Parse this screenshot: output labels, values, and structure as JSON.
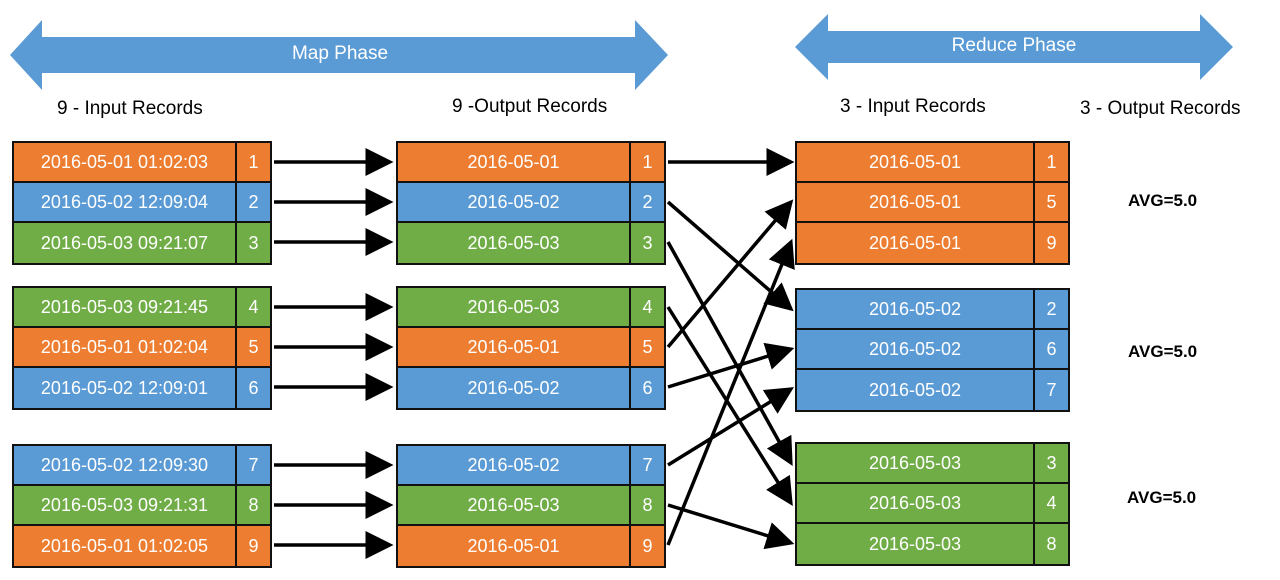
{
  "colors": {
    "arrow_fill": "#5b9bd5",
    "orange": "#ed7d31",
    "blue": "#5b9bd5",
    "green": "#70ad47",
    "connector": "#000000"
  },
  "phases": {
    "map": "Map Phase",
    "reduce": "Reduce Phase"
  },
  "headers": {
    "map_input": "9 - Input Records",
    "map_output": "9 -Output Records",
    "reduce_input": "3 - Input Records",
    "reduce_output": "3 - Output Records"
  },
  "map_input": [
    [
      {
        "key": "2016-05-01 01:02:03",
        "value": "1",
        "color": "orange"
      },
      {
        "key": "2016-05-02 12:09:04",
        "value": "2",
        "color": "blue"
      },
      {
        "key": "2016-05-03 09:21:07",
        "value": "3",
        "color": "green"
      }
    ],
    [
      {
        "key": "2016-05-03 09:21:45",
        "value": "4",
        "color": "green"
      },
      {
        "key": "2016-05-01 01:02:04",
        "value": "5",
        "color": "orange"
      },
      {
        "key": "2016-05-02 12:09:01",
        "value": "6",
        "color": "blue"
      }
    ],
    [
      {
        "key": "2016-05-02 12:09:30",
        "value": "7",
        "color": "blue"
      },
      {
        "key": "2016-05-03 09:21:31",
        "value": "8",
        "color": "green"
      },
      {
        "key": "2016-05-01 01:02:05",
        "value": "9",
        "color": "orange"
      }
    ]
  ],
  "map_output": [
    [
      {
        "key": "2016-05-01",
        "value": "1",
        "color": "orange"
      },
      {
        "key": "2016-05-02",
        "value": "2",
        "color": "blue"
      },
      {
        "key": "2016-05-03",
        "value": "3",
        "color": "green"
      }
    ],
    [
      {
        "key": "2016-05-03",
        "value": "4",
        "color": "green"
      },
      {
        "key": "2016-05-01",
        "value": "5",
        "color": "orange"
      },
      {
        "key": "2016-05-02",
        "value": "6",
        "color": "blue"
      }
    ],
    [
      {
        "key": "2016-05-02",
        "value": "7",
        "color": "blue"
      },
      {
        "key": "2016-05-03",
        "value": "8",
        "color": "green"
      },
      {
        "key": "2016-05-01",
        "value": "9",
        "color": "orange"
      }
    ]
  ],
  "reduce_input": [
    [
      {
        "key": "2016-05-01",
        "value": "1",
        "color": "orange"
      },
      {
        "key": "2016-05-01",
        "value": "5",
        "color": "orange"
      },
      {
        "key": "2016-05-01",
        "value": "9",
        "color": "orange"
      }
    ],
    [
      {
        "key": "2016-05-02",
        "value": "2",
        "color": "blue"
      },
      {
        "key": "2016-05-02",
        "value": "6",
        "color": "blue"
      },
      {
        "key": "2016-05-02",
        "value": "7",
        "color": "blue"
      }
    ],
    [
      {
        "key": "2016-05-03",
        "value": "3",
        "color": "green"
      },
      {
        "key": "2016-05-03",
        "value": "4",
        "color": "green"
      },
      {
        "key": "2016-05-03",
        "value": "8",
        "color": "green"
      }
    ]
  ],
  "reduce_output": [
    "AVG=5.0",
    "AVG=5.0",
    "AVG=5.0"
  ],
  "shuffle": [
    {
      "from": "1",
      "to": "1"
    },
    {
      "from": "2",
      "to": "2"
    },
    {
      "from": "3",
      "to": "3"
    },
    {
      "from": "4",
      "to": "4"
    },
    {
      "from": "5",
      "to": "5"
    },
    {
      "from": "6",
      "to": "6"
    },
    {
      "from": "7",
      "to": "7"
    },
    {
      "from": "8",
      "to": "8"
    },
    {
      "from": "9",
      "to": "9"
    }
  ]
}
